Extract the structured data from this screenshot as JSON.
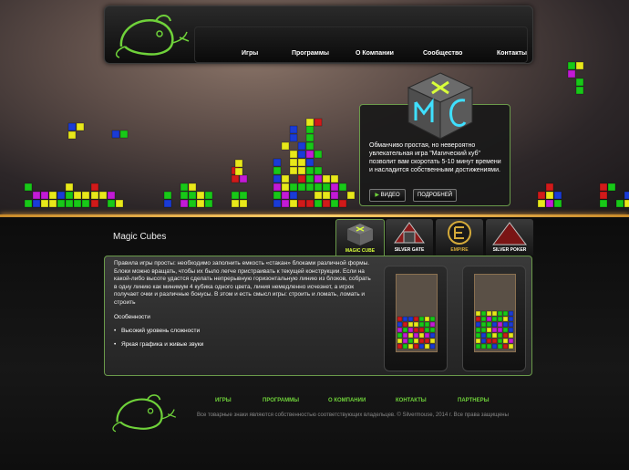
{
  "nav": {
    "items": [
      {
        "label": "Игры"
      },
      {
        "label": "Программы"
      },
      {
        "label": "О Компании"
      },
      {
        "label": "Сообщество"
      },
      {
        "label": "Контакты"
      }
    ]
  },
  "promo": {
    "text": "Обманчиво простая, но невероятно увлекательная игра \"Магический куб\" позволит вам скоротать 5-10 минут времени и насладится собственными достижениями.",
    "video_label": "ВИДЕО",
    "details_label": "ПОДРОБНЕЙ"
  },
  "page": {
    "title": "Magic Cubes"
  },
  "game_tabs": [
    {
      "label": "MAGIC CUBE"
    },
    {
      "label": "SILVER GATE"
    },
    {
      "label": "EMPIRE"
    },
    {
      "label": "SILVER POKER"
    }
  ],
  "main": {
    "description": "Правила игры просты: необходимо заполнить емкость «стакан» блоками различной формы. Блоки можно вращать, чтобы их было легче пристраивать к текущей конструкции. Если на какой-либо высоте удастся сделать непрерывную горизонтальную линию из блоков, собрать в одну линию как минимум 4 кубика одного цвета, линия немедленно исчезнет, а игрок получает очки и различные бонусы. В этом и есть смысл игры: строить и ломать, ломать и строить",
    "features_title": "Особенности",
    "features": [
      "Высокий уровень сложности",
      "Яркая графика и живые звуки"
    ]
  },
  "footer": {
    "links": [
      "ИГРЫ",
      "ПРОГРАММЫ",
      "О КОМПАНИИ",
      "КОНТАКТЫ",
      "ПАРТНЕРЫ"
    ],
    "copyright": "Все товарные знаки являются собственностью соответствующих владельцев. © Silvermouse, 2014 г. Все права защищены"
  },
  "colors": {
    "accent_green": "#6fd23a",
    "gold_divider": "#ffcf6a"
  }
}
